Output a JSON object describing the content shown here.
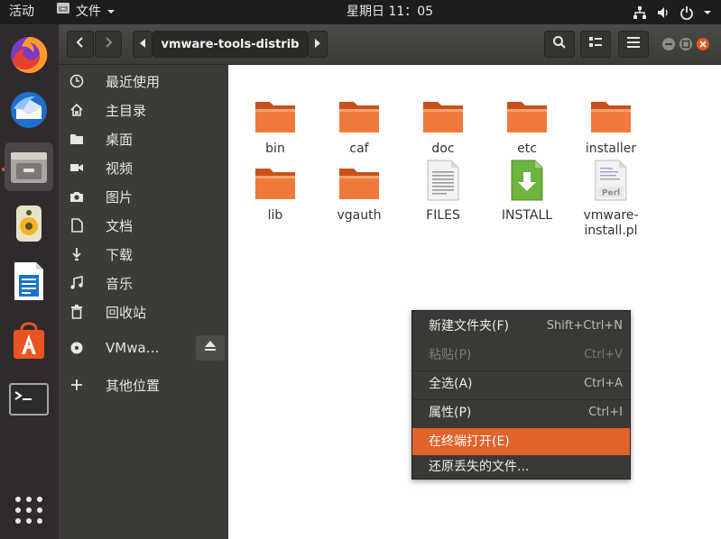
{
  "topbar": {
    "activities": "活动",
    "app_menu": "文件",
    "clock": "星期日 11：05"
  },
  "dock": {
    "items": [
      "firefox-icon",
      "thunderbird-icon",
      "files-icon",
      "rhythmbox-icon",
      "writer-icon",
      "software-icon",
      "terminal-icon",
      "app-grid-icon"
    ]
  },
  "header": {
    "path": "vmware-tools-distrib"
  },
  "sidebar": {
    "items": [
      {
        "label": "最近使用",
        "icon": "clock-icon"
      },
      {
        "label": "主目录",
        "icon": "home-icon"
      },
      {
        "label": "桌面",
        "icon": "folder-icon"
      },
      {
        "label": "视频",
        "icon": "video-icon"
      },
      {
        "label": "图片",
        "icon": "camera-icon"
      },
      {
        "label": "文档",
        "icon": "document-icon"
      },
      {
        "label": "下载",
        "icon": "download-icon"
      },
      {
        "label": "音乐",
        "icon": "music-icon"
      },
      {
        "label": "回收站",
        "icon": "trash-icon"
      },
      {
        "label": "VMwa…",
        "icon": "disc-icon"
      },
      {
        "label": "其他位置",
        "icon": "plus-icon"
      }
    ]
  },
  "files": [
    {
      "name": "bin",
      "type": "folder"
    },
    {
      "name": "caf",
      "type": "folder"
    },
    {
      "name": "doc",
      "type": "folder"
    },
    {
      "name": "etc",
      "type": "folder"
    },
    {
      "name": "installer",
      "type": "folder"
    },
    {
      "name": "lib",
      "type": "folder"
    },
    {
      "name": "vgauth",
      "type": "folder"
    },
    {
      "name": "FILES",
      "type": "text"
    },
    {
      "name": "INSTALL",
      "type": "install"
    },
    {
      "name": "vmware-install.pl",
      "type": "perl",
      "line1": "vmware-",
      "line2": "install.pl",
      "badge": "Perl"
    }
  ],
  "context_menu": {
    "items": [
      {
        "label": "新建文件夹(F)",
        "accel": "Shift+Ctrl+N"
      },
      {
        "label": "粘贴(P)",
        "accel": "Ctrl+V"
      },
      {
        "label": "全选(A)",
        "accel": "Ctrl+A"
      },
      {
        "label": "属性(P)",
        "accel": "Ctrl+I"
      },
      {
        "label": "在终端打开(E)",
        "accel": ""
      },
      {
        "label": "还原丢失的文件...",
        "accel": ""
      }
    ]
  },
  "colors": {
    "accent": "#e95420",
    "folder": "#f07a3c",
    "menu_highlight": "#e2622c"
  }
}
